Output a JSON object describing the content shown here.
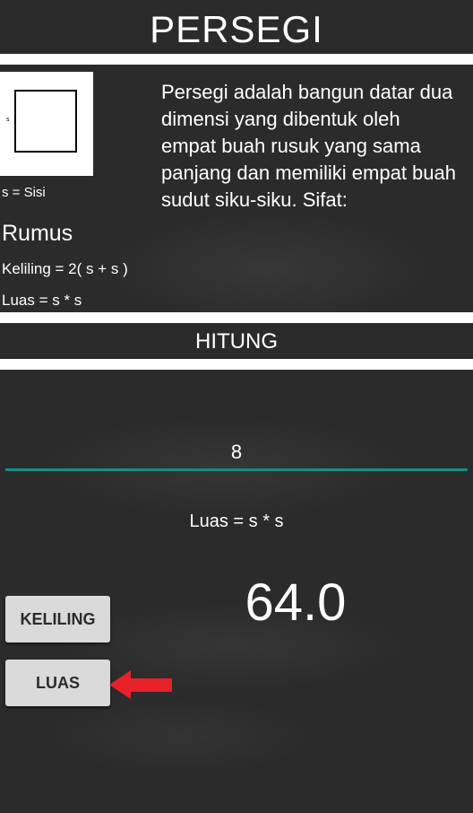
{
  "header": {
    "title": "PERSEGI"
  },
  "info": {
    "shape_label": "s",
    "legend": "s = Sisi",
    "formula_heading": "Rumus",
    "keliling_formula": "Keliling = 2( s + s )",
    "luas_formula": "Luas = s * s",
    "description": "Persegi adalah bangun datar dua dimensi yang dibentuk oleh empat buah rusuk yang sama panjang dan memiliki empat buah sudut siku-siku. Sifat:"
  },
  "calc": {
    "section_title": "HITUNG",
    "input_value": "8",
    "formula": "Luas = s * s",
    "result": "64.0"
  },
  "buttons": {
    "keliling": "KELILING",
    "luas": "LUAS"
  },
  "colors": {
    "background": "#2b2b2b",
    "input_underline": "#128f86",
    "arrow": "#e8202a",
    "button": "#dadada"
  }
}
